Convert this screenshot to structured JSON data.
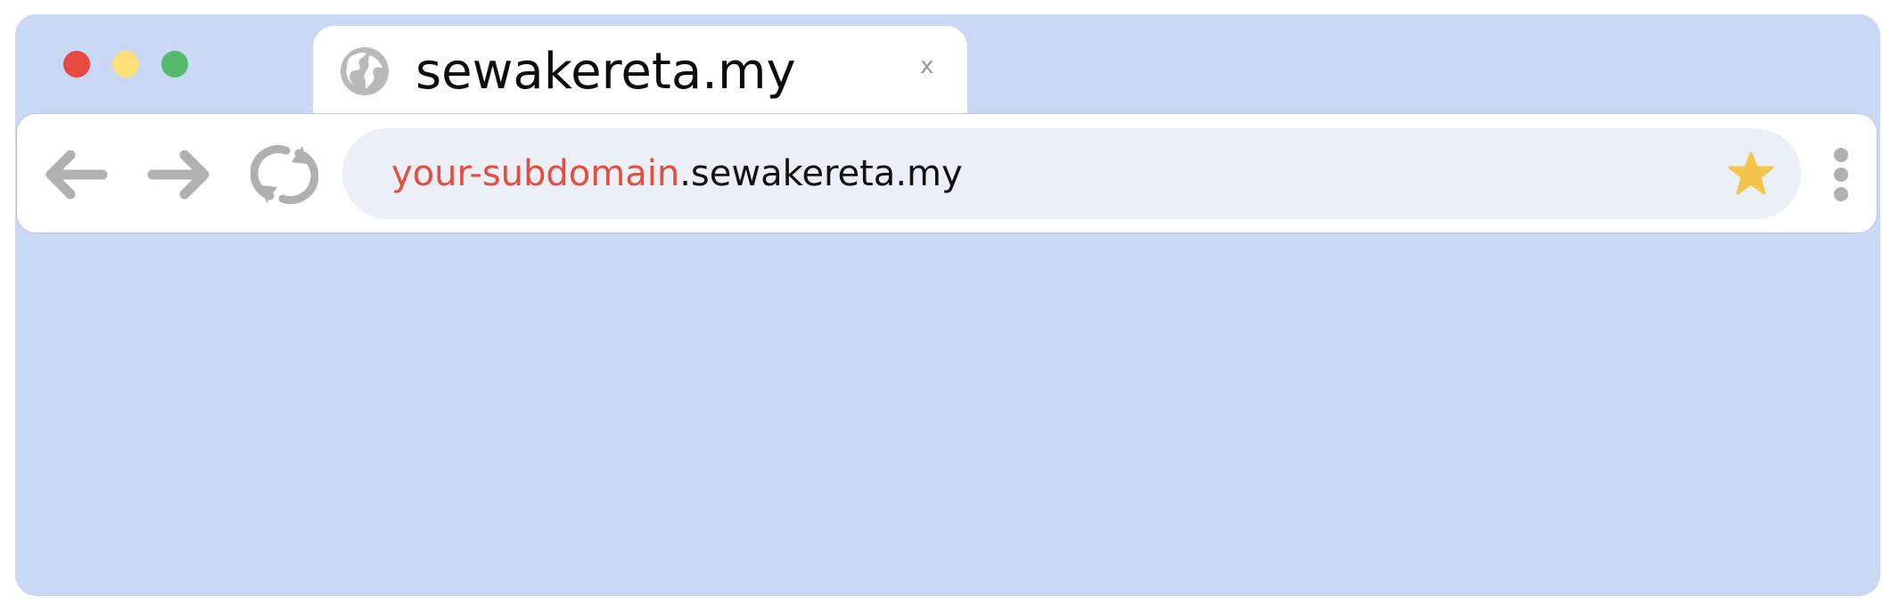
{
  "window": {
    "background": "#c9d9f5",
    "traffic_lights": [
      "#e94a40",
      "#fbe07a",
      "#55b86b"
    ]
  },
  "tab": {
    "title": "sewakereta.my",
    "close_label": "x",
    "icon": "globe-icon"
  },
  "toolbar": {
    "back_icon": "arrow-left-icon",
    "forward_icon": "arrow-right-icon",
    "reload_icon": "reload-icon",
    "bookmark_icon": "star-icon",
    "menu_icon": "kebab-menu-icon"
  },
  "address": {
    "subdomain": "your-subdomain",
    "domain": ".sewakereta.my",
    "subdomain_color": "#e74c3c",
    "star_color": "#f3c54a"
  }
}
